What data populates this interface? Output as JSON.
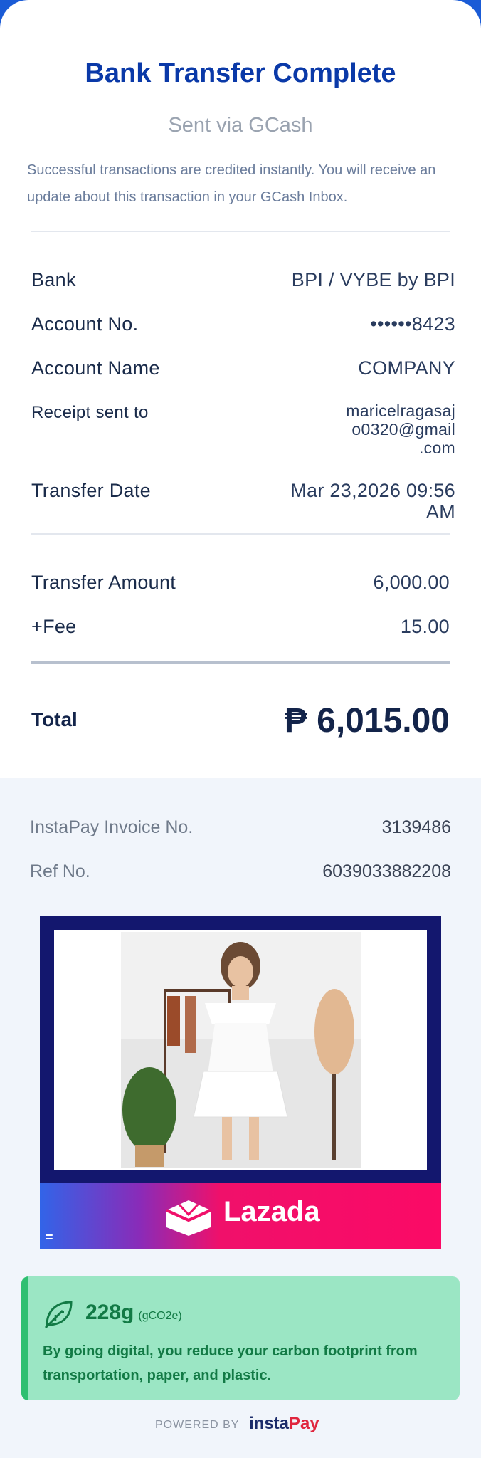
{
  "header": {
    "title": "Bank Transfer Complete",
    "subtitle": "Sent via GCash",
    "description": "Successful transactions are credited instantly. You will receive an update about this transaction in your GCash Inbox."
  },
  "details": {
    "bank_label": "Bank",
    "bank_value": "BPI / VYBE by BPI",
    "account_no_label": "Account No.",
    "account_no_value": "••••••8423",
    "account_name_label": "Account Name",
    "account_name_value": "COMPANY",
    "receipt_label": "Receipt sent to",
    "receipt_value_line1": "maricelragasaj",
    "receipt_value_line2": "o0320@gmail",
    "receipt_value_line3": ".com",
    "date_label": "Transfer Date",
    "date_value_line1": "Mar 23,2026 09:56",
    "date_value_line2": "AM"
  },
  "amounts": {
    "transfer_label": "Transfer Amount",
    "transfer_value": "6,000.00",
    "fee_label": "+Fee",
    "fee_value": "15.00",
    "total_label": "Total",
    "total_value": "₱ 6,015.00"
  },
  "meta": {
    "invoice_label": "InstaPay Invoice No.",
    "invoice_value": "3139486",
    "ref_label": "Ref No.",
    "ref_value": "6039033882208"
  },
  "ad": {
    "brand": "Lazada",
    "menu_glyph": "=",
    "colors": {
      "frame": "#13176e",
      "banner_start": "#3264e8",
      "banner_end": "#fb0a66"
    }
  },
  "eco": {
    "amount": "228g",
    "unit": "(gCO2e)",
    "message": "By going digital, you reduce your carbon footprint from transportation, paper, and plastic.",
    "icon": "leaf-icon"
  },
  "footer": {
    "powered_by": "POWERED BY",
    "logo_insta": "insta",
    "logo_pay": "Pay"
  },
  "colors": {
    "title": "#0a39a8",
    "text_dark": "#13244a",
    "eco_bg": "#9be6c4",
    "eco_text": "#127a45"
  }
}
